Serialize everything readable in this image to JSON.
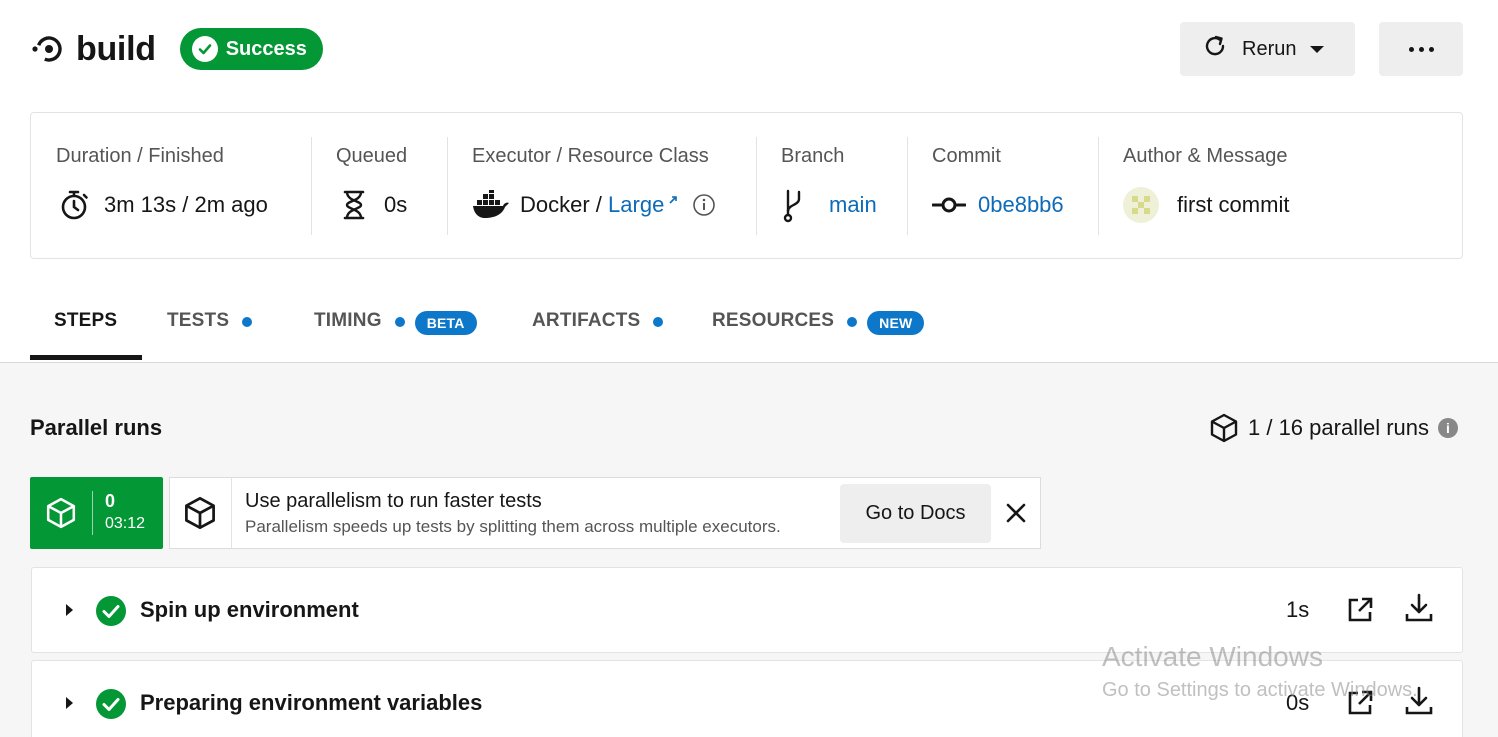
{
  "header": {
    "job_name": "build",
    "status": "Success",
    "rerun_label": "Rerun",
    "colors": {
      "success": "#039735",
      "link": "#0d6bb8",
      "accent": "#0d78c9"
    }
  },
  "info": {
    "duration": {
      "label": "Duration / Finished",
      "value": "3m 13s / 2m ago",
      "icon": "stopwatch-icon"
    },
    "queued": {
      "label": "Queued",
      "value": "0s",
      "icon": "hourglass-icon"
    },
    "executor": {
      "label": "Executor / Resource Class",
      "executor": "Docker / ",
      "resource_class": "Large",
      "icon": "docker-icon"
    },
    "branch": {
      "label": "Branch",
      "value": "main",
      "icon": "branch-icon"
    },
    "commit": {
      "label": "Commit",
      "value": "0be8bb6",
      "icon": "commit-icon"
    },
    "author": {
      "label": "Author & Message",
      "message": "first commit"
    }
  },
  "tabs": [
    {
      "label": "STEPS"
    },
    {
      "label": "TESTS"
    },
    {
      "label": "TIMING",
      "pill": "BETA"
    },
    {
      "label": "ARTIFACTS"
    },
    {
      "label": "RESOURCES",
      "pill": "NEW"
    }
  ],
  "parallel": {
    "title": "Parallel runs",
    "count_text": "1 / 16 parallel runs",
    "info_glyph": "i",
    "run": {
      "index": "0",
      "time": "03:12"
    },
    "promo": {
      "title": "Use parallelism to run faster tests",
      "subtitle": "Parallelism speeds up tests by splitting them across multiple executors.",
      "docs_label": "Go to Docs"
    }
  },
  "steps": [
    {
      "name": "Spin up environment",
      "duration": "1s"
    },
    {
      "name": "Preparing environment variables",
      "duration": "0s"
    }
  ],
  "watermark": {
    "line1": "Activate Windows",
    "line2": "Go to Settings to activate Windows."
  }
}
